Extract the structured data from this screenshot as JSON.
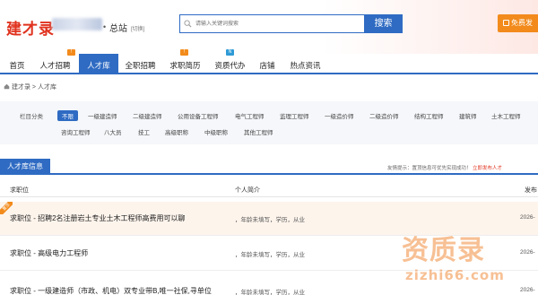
{
  "header": {
    "logo": "建才录",
    "site_dot": "•",
    "site_name": "总站",
    "site_switch": "[切换]",
    "search_placeholder": "请输入关键词搜索",
    "search_button": "搜索",
    "post_button": "免费发"
  },
  "nav": {
    "items": [
      {
        "label": "首页"
      },
      {
        "label": "人才招聘",
        "badge": "hot"
      },
      {
        "label": "人才库",
        "active": true
      },
      {
        "label": "全职招聘"
      },
      {
        "label": "求职简历",
        "badge": "hot"
      },
      {
        "label": "资质代办",
        "badge": "new"
      },
      {
        "label": "店铺"
      },
      {
        "label": "热点资讯"
      }
    ]
  },
  "breadcrumb": [
    "建才录",
    ">",
    "人才库"
  ],
  "filter": {
    "label": "栏目分类",
    "row1": [
      "不限",
      "一级建造师",
      "二级建造师",
      "公用设备工程师",
      "电气工程师",
      "监理工程师",
      "一级造价师",
      "二级造价师",
      "结构工程师",
      "建筑师",
      "土木工程师"
    ],
    "row2": [
      "咨询工程师",
      "八大员",
      "技工",
      "高级职称",
      "中级职称",
      "其他工程师"
    ]
  },
  "section": {
    "title": "人才库信息",
    "tip_prefix": "友情提示：置顶信息可优先实现成功！",
    "tip_link": "立即发布人才"
  },
  "columns": {
    "position": "求职位",
    "intro": "个人简介",
    "published": "发布"
  },
  "rows": [
    {
      "title": "求职位 - 招聘2名注册岩土专业土木工程师高费用可以聊",
      "meta": "，年龄未填写，学历，从业",
      "date": "2026-",
      "pinned": true,
      "ribbon": "置顶"
    },
    {
      "title": "求职位 - 高级电力工程师",
      "meta": "，年龄未填写，学历，从业",
      "date": "2026-",
      "pinned": false
    },
    {
      "title": "求职位 - 一级建造师（市政、机电）双专业带B,唯一社保,寻单位",
      "meta": "，年龄未填写，学历，从业",
      "date": "2026-",
      "pinned": false
    }
  ],
  "watermark": {
    "big": "资质录",
    "small": "zizhi66.com"
  },
  "colors": {
    "primary": "#2f6bc3",
    "brand_red": "#e0321e",
    "accent_orange": "#f28b1c"
  }
}
